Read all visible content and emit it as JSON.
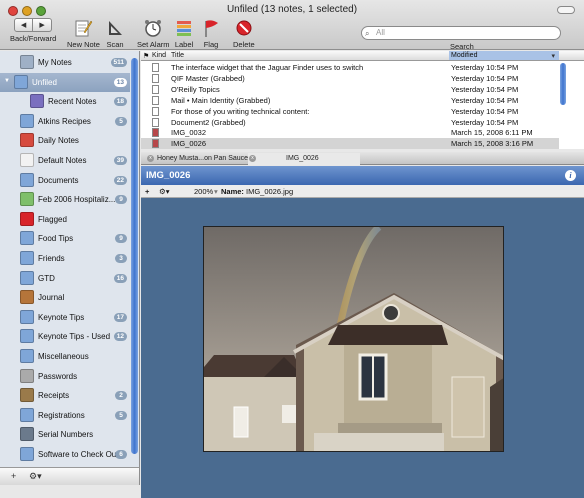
{
  "window": {
    "title": "Unfiled (13 notes, 1 selected)"
  },
  "colors": {
    "accent": "#3b67b0",
    "sidebar": "#dfe5ed",
    "image_bg": "#4a6b90",
    "selection": "#d4d4d4"
  },
  "toolbar": {
    "back_forward_label": "Back/Forward",
    "new_note_label": "New Note",
    "scan_label": "Scan",
    "set_alarm_label": "Set Alarm",
    "label_label": "Label",
    "flag_label": "Flag",
    "delete_label": "Delete",
    "search_placeholder": "All",
    "search_label": "Search"
  },
  "sidebar": {
    "items": [
      {
        "label": "My Notes",
        "badge": "511",
        "icon": "notebook-icon"
      },
      {
        "label": "Unfiled",
        "badge": "13",
        "icon": "folder-icon",
        "selected": true
      },
      {
        "label": "Recent Notes",
        "badge": "18",
        "icon": "smart-folder-icon"
      },
      {
        "label": "Atkins Recipes",
        "badge": "5",
        "icon": "folder-icon"
      },
      {
        "label": "Daily Notes",
        "badge": "",
        "icon": "calendar-icon"
      },
      {
        "label": "Default Notes",
        "badge": "39",
        "icon": "notes-icon"
      },
      {
        "label": "Documents",
        "badge": "22",
        "icon": "folder-icon"
      },
      {
        "label": "Feb 2006 Hospitaliz...",
        "badge": "9",
        "icon": "green-folder-icon"
      },
      {
        "label": "Flagged",
        "badge": "",
        "icon": "flag-icon"
      },
      {
        "label": "Food Tips",
        "badge": "9",
        "icon": "folder-icon"
      },
      {
        "label": "Friends",
        "badge": "3",
        "icon": "folder-icon"
      },
      {
        "label": "GTD",
        "badge": "16",
        "icon": "folder-icon"
      },
      {
        "label": "Journal",
        "badge": "",
        "icon": "journal-icon"
      },
      {
        "label": "Keynote Tips",
        "badge": "17",
        "icon": "folder-icon"
      },
      {
        "label": "Keynote Tips - Used",
        "badge": "12",
        "icon": "folder-icon"
      },
      {
        "label": "Miscellaneous",
        "badge": "",
        "icon": "folder-icon"
      },
      {
        "label": "Passwords",
        "badge": "",
        "icon": "keys-icon"
      },
      {
        "label": "Receipts",
        "badge": "2",
        "icon": "receipts-icon"
      },
      {
        "label": "Registrations",
        "badge": "5",
        "icon": "folder-icon"
      },
      {
        "label": "Serial Numbers",
        "badge": "",
        "icon": "serial-icon"
      },
      {
        "label": "Software to Check Out",
        "badge": "6",
        "icon": "folder-icon"
      }
    ]
  },
  "sidebar_footer": {
    "add_label": "+",
    "action_label": "⚙▾"
  },
  "list": {
    "columns": {
      "kind": "Kind",
      "title": "Title",
      "modified": "Modified"
    },
    "rows": [
      {
        "title": "The interface widget that the Jaguar Finder uses to switch",
        "modified": "Yesterday 10:54 PM"
      },
      {
        "title": "QIF Master (Grabbed)",
        "modified": "Yesterday 10:54 PM"
      },
      {
        "title": "O'Reilly Topics",
        "modified": "Yesterday 10:54 PM"
      },
      {
        "title": "Mail • Main Identity (Grabbed)",
        "modified": "Yesterday 10:54 PM"
      },
      {
        "title": "For those of you writing technical content:",
        "modified": "Yesterday 10:54 PM"
      },
      {
        "title": "Document2 (Grabbed)",
        "modified": "Yesterday 10:54 PM"
      },
      {
        "title": "IMG_0032",
        "modified": "March 15, 2008 6:11 PM"
      },
      {
        "title": "IMG_0026",
        "modified": "March 15, 2008 3:16 PM",
        "selected": true
      }
    ]
  },
  "tabs": [
    {
      "label": "Honey Musta...on Pan Sauce"
    },
    {
      "label": "IMG_0026"
    }
  ],
  "note": {
    "title": "IMG_0026",
    "zoom": "200%",
    "name_label": "Name:",
    "name_value": "IMG_0026.jpg",
    "add": "+",
    "gear": "⚙▾"
  }
}
